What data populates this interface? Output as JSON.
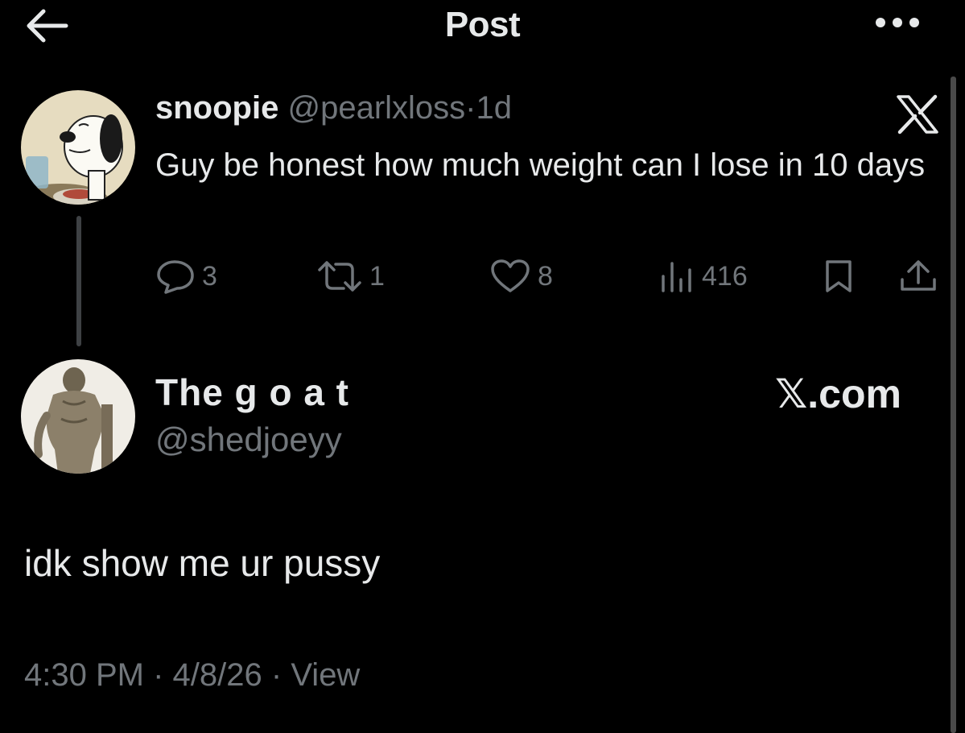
{
  "header": {
    "title": "Post",
    "back_icon": "arrow-left-icon",
    "more_icon": "more-horizontal-icon"
  },
  "parent_tweet": {
    "display_name": "snoopie",
    "handle": "@pearlxloss",
    "separator": "·",
    "age": "1d",
    "text": "Guy be honest how much weight can I lose in 10 days",
    "avatar_icon": "snoopy-avatar",
    "watermark_icon": "x-logo-icon",
    "actions": {
      "reply_count": "3",
      "retweet_count": "1",
      "like_count": "8",
      "views_count": "416"
    }
  },
  "reply": {
    "display_name": "The g o a t",
    "handle": "@shedjoeyy",
    "watermark": "𝕏.com",
    "avatar_icon": "statue-avatar",
    "text": "idk show me ur pussy",
    "time": "4:30 PM",
    "date": "4/8/26",
    "separator": "·",
    "view_label": "View"
  },
  "colors": {
    "background": "#000000",
    "primary_text": "#e7e9ea",
    "secondary_text": "#71767b"
  }
}
